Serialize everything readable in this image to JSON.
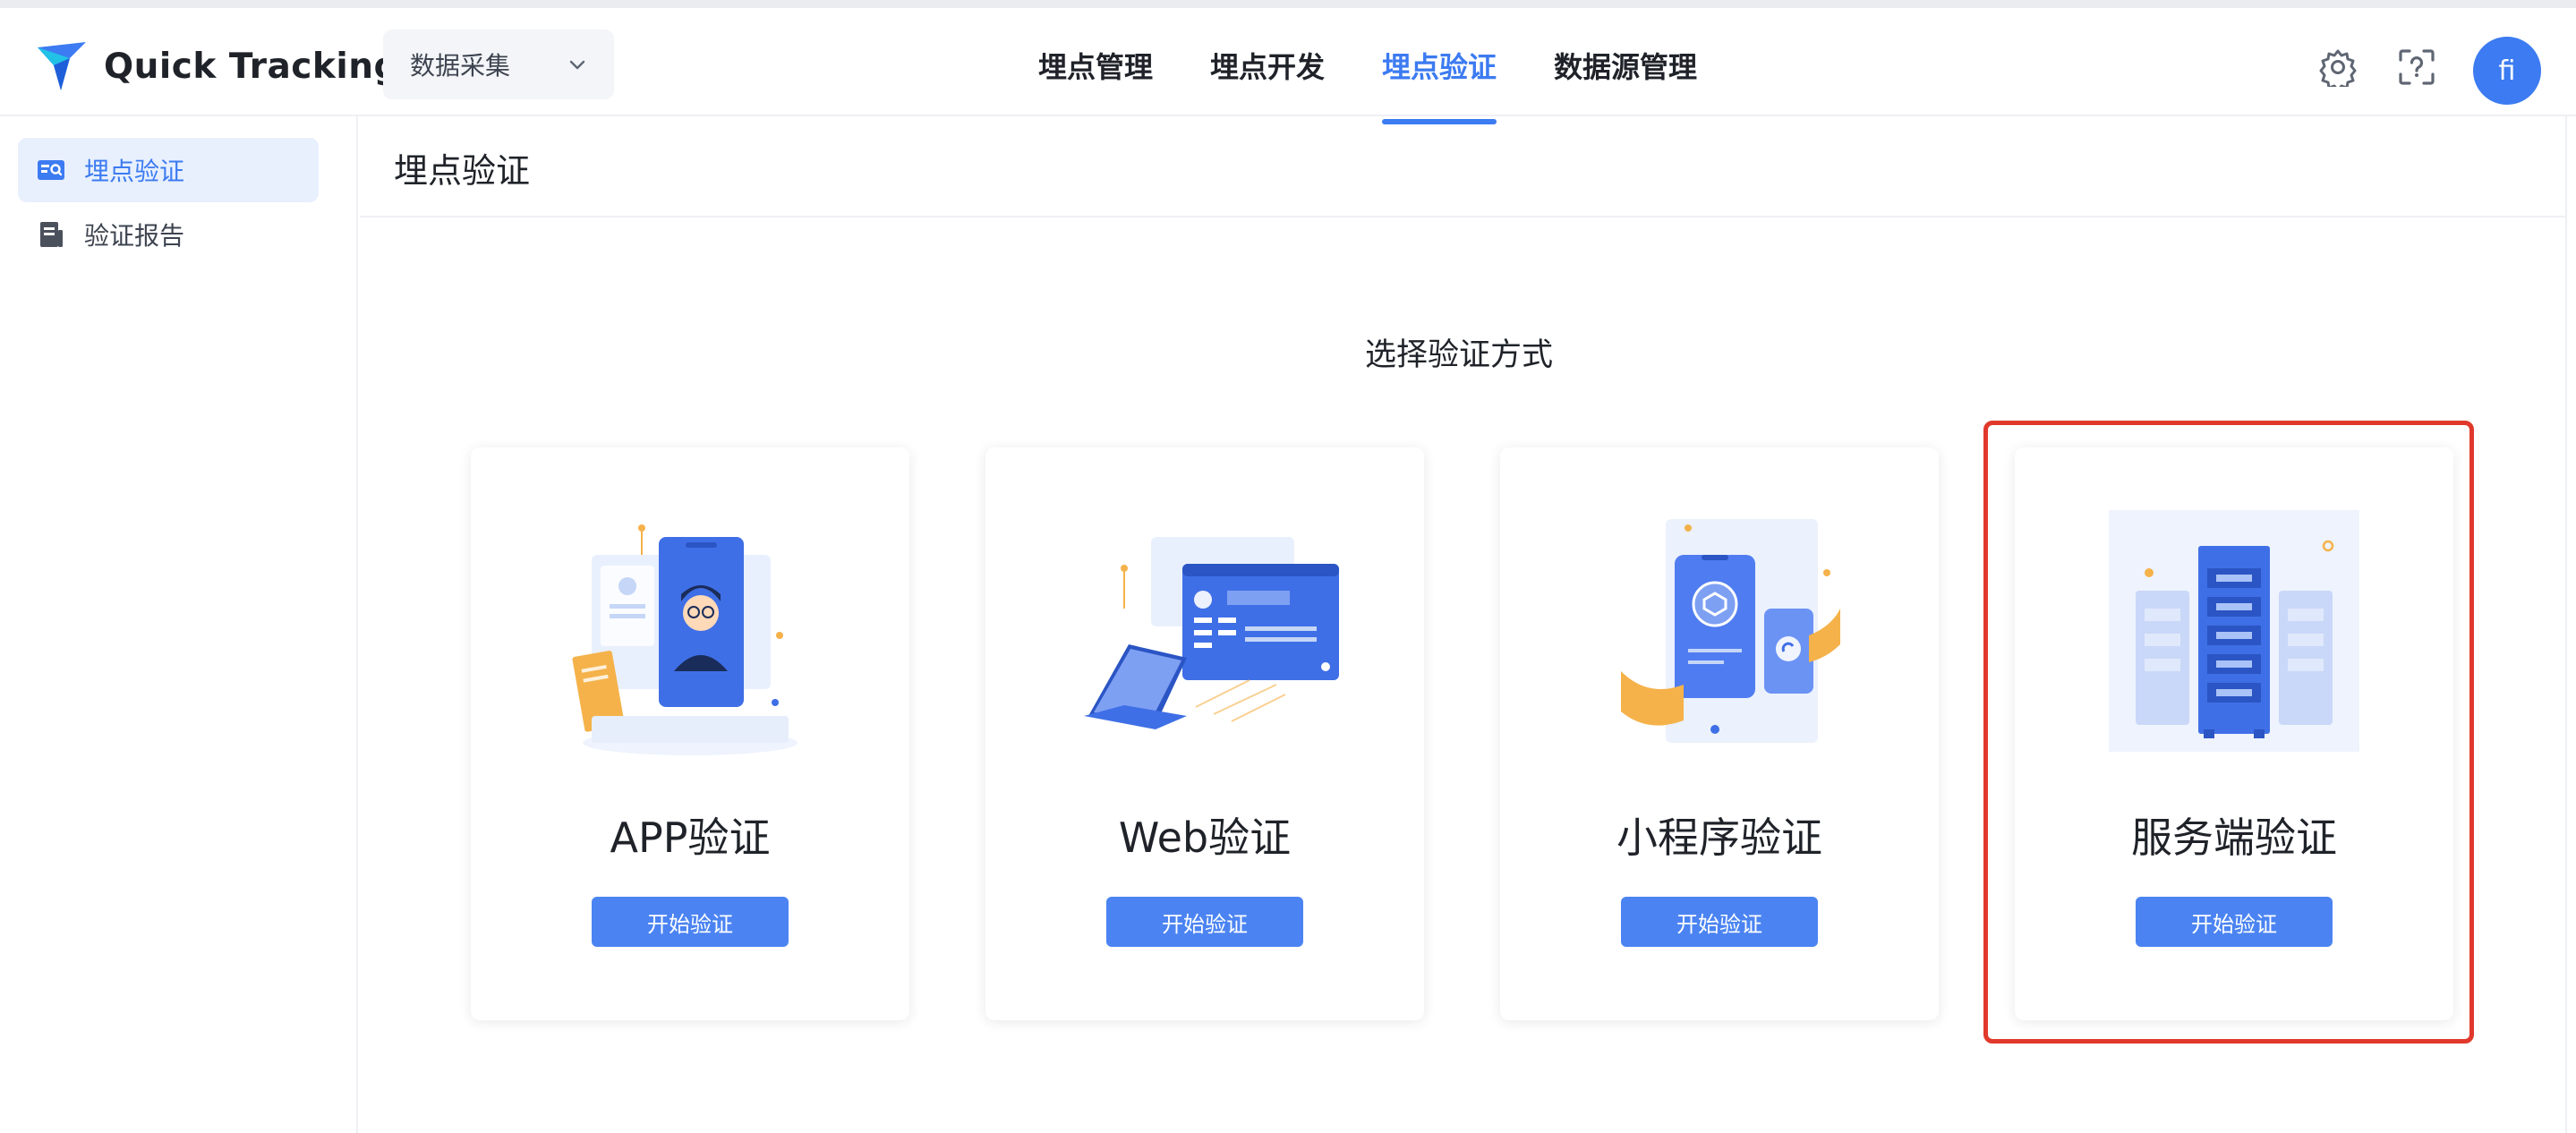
{
  "app": {
    "name": "Quick Tracking"
  },
  "project_selector": {
    "value": "数据采集"
  },
  "nav": {
    "items": [
      {
        "label": "埋点管理"
      },
      {
        "label": "埋点开发"
      },
      {
        "label": "埋点验证",
        "active": true
      },
      {
        "label": "数据源管理"
      }
    ]
  },
  "header": {
    "avatar_text": "fi"
  },
  "sidebar": {
    "items": [
      {
        "label": "埋点验证",
        "active": true
      },
      {
        "label": "验证报告"
      }
    ]
  },
  "page": {
    "title": "埋点验证",
    "section_title": "选择验证方式"
  },
  "cards": [
    {
      "title": "APP验证",
      "button": "开始验证"
    },
    {
      "title": "Web验证",
      "button": "开始验证"
    },
    {
      "title": "小程序验证",
      "button": "开始验证"
    },
    {
      "title": "服务端验证",
      "button": "开始验证",
      "highlighted": true
    }
  ],
  "colors": {
    "accent": "#3c7bf1",
    "button": "#4b84f2",
    "highlight": "#e0392b",
    "illustration_orange": "#f5b24a"
  }
}
